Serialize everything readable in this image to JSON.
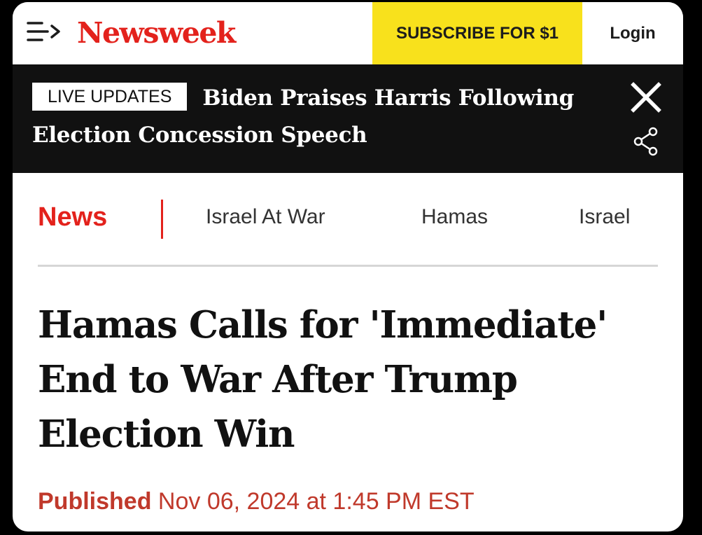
{
  "header": {
    "logo": "Newsweek",
    "subscribe_label": "SUBSCRIBE FOR $1",
    "login_label": "Login"
  },
  "live": {
    "badge": "LIVE UPDATES",
    "headline": "Biden Praises Harris Following Election Concession Speech"
  },
  "nav": {
    "section": "News",
    "links": [
      "Israel At War",
      "Hamas",
      "Israel"
    ]
  },
  "article": {
    "headline": "Hamas Calls for 'Immediate' End to War After Trump Election Win",
    "published_label": "Published",
    "published_date": "Nov 06, 2024 at 1:45 PM EST"
  },
  "colors": {
    "brand_red": "#e3221c",
    "subscribe_yellow": "#f8e11c",
    "banner_bg": "#111111"
  },
  "icons": {
    "menu": "menu-arrow-icon",
    "close": "close-icon",
    "share": "share-icon"
  }
}
